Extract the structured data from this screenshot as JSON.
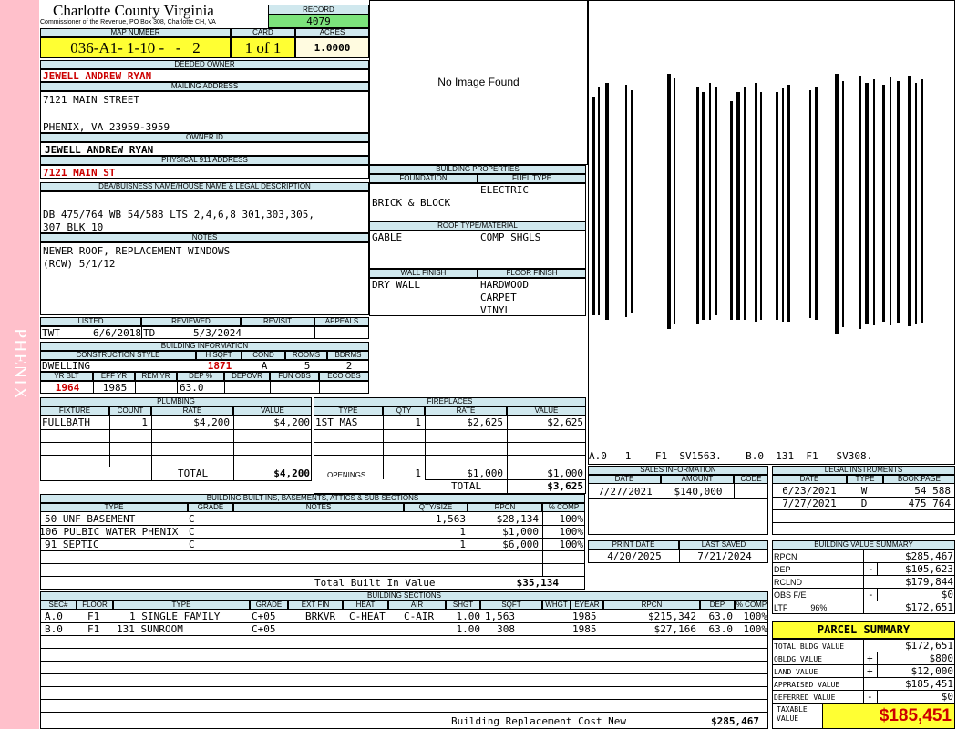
{
  "sidebar": {
    "text": "PHENIX",
    "color": "#ffc0cb"
  },
  "header": {
    "title": "Charlotte County Virginia",
    "subtitle": "Commissioner of the Revenue, PO Box 308, Charlotte CH, VA",
    "record_label": "RECORD",
    "record": "4079"
  },
  "map": {
    "map_label": "MAP NUMBER",
    "map_number": "036-A1- 1-10 -   -   2",
    "card_label": "CARD",
    "card": "1 of 1",
    "acres_label": "ACRES",
    "acres": "1.0000"
  },
  "owner": {
    "deeded_label": "DEEDED OWNER",
    "deeded_owner": "JEWELL ANDREW RYAN",
    "mailing_label": "MAILING ADDRESS",
    "mailing_line1": "7121 MAIN STREET",
    "mailing_line2": "PHENIX, VA 23959-3959",
    "owner_id_label": "OWNER ID",
    "owner_id": "JEWELL ANDREW RYAN",
    "address_label": "PHYSICAL 911 ADDRESS",
    "address": "7121 MAIN ST"
  },
  "legal": {
    "label": "DBA/BUISNESS NAME/HOUSE NAME & LEGAL DESCRIPTION",
    "line1": "DB 475/764 WB 54/588 LTS 2,4,6,8 301,303,305,",
    "line2": "307 BLK 10"
  },
  "notes": {
    "label": "NOTES",
    "line1": "NEWER ROOF, REPLACEMENT WINDOWS",
    "line2": "(RCW) 5/1/12"
  },
  "photo": {
    "text": "No Image Found"
  },
  "listing": {
    "listed_label": "LISTED",
    "reviewed_label": "REVIEWED",
    "revisit_label": "REVISIT",
    "appeals_label": "APPEALS",
    "listed_by": "TWT",
    "listed_date": "6/6/2018",
    "reviewed_by": "TD",
    "reviewed_date": "5/3/2024"
  },
  "building_info": {
    "label": "BUILDING INFORMATION",
    "style_label": "CONSTRUCTION STYLE",
    "hsqft_label": "H SQFT",
    "cond_label": "COND",
    "rooms_label": "ROOMS",
    "bdrms_label": "BDRMS",
    "style": "DWELLING",
    "hsqft": "1871",
    "cond": "A",
    "rooms": "5",
    "bdrms": "2",
    "yrblt_label": "YR BLT",
    "effyr_label": "EFF YR",
    "remyr_label": "REM YR",
    "dep_label": "DEP %",
    "depovr_label": "DEPOVR",
    "funobs_label": "FUN OBS",
    "ecoobs_label": "ECO OBS",
    "yrblt": "1964",
    "effyr": "1985",
    "dep": "63.0"
  },
  "props": {
    "label": "BUILDING PROPERTIES",
    "foundation_label": "FOUNDATION",
    "fuel_label": "FUEL TYPE",
    "foundation": "BRICK & BLOCK",
    "fuel": "ELECTRIC",
    "roof_label": "ROOF TYPE/MATERIAL",
    "roof_type": "GABLE",
    "roof_material": "COMP SHGLS",
    "wall_label": "WALL FINISH",
    "floor_label": "FLOOR FINISH",
    "wall": "DRY WALL",
    "floor1": "HARDWOOD",
    "floor2": "CARPET",
    "floor3": "VINYL"
  },
  "sketch": {
    "caption": "A.0   1    F1  SV1563.    B.0  131  F1   SV308."
  },
  "plumbing": {
    "label": "PLUMBING",
    "headers": [
      "FIXTURE",
      "COUNT",
      "RATE",
      "VALUE"
    ],
    "row": [
      "FULLBATH",
      "1",
      "$4,200",
      "$4,200"
    ],
    "total_label": "TOTAL",
    "total": "$4,200"
  },
  "fireplaces": {
    "label": "FIREPLACES",
    "headers": [
      "TYPE",
      "QTY",
      "RATE",
      "VALUE"
    ],
    "row": [
      "1ST MAS",
      "1",
      "$2,625",
      "$2,625"
    ],
    "openings_label": "OPENINGS",
    "openings": [
      "1",
      "$1,000",
      "$1,000"
    ],
    "total_label": "TOTAL",
    "total": "$3,625"
  },
  "sales": {
    "label": "SALES INFORMATION",
    "headers": [
      "DATE",
      "AMOUNT",
      "CODE"
    ],
    "row": [
      "7/27/2021",
      "$140,000",
      ""
    ]
  },
  "legal_instr": {
    "label": "LEGAL INSTRUMENTS",
    "headers": [
      "DATE",
      "TYPE",
      "BOOK:PAGE"
    ],
    "rows": [
      [
        "6/23/2021",
        "W",
        "54 588"
      ],
      [
        "7/27/2021",
        "D",
        "475 764"
      ]
    ]
  },
  "builtins": {
    "label": "BUILDING BUILT INS, BASEMENTS, ATTICS & SUB SECTIONS",
    "headers": [
      "TYPE",
      "GRADE",
      "NOTES",
      "QTY/SIZE",
      "RPCN",
      "% COMP"
    ],
    "rows": [
      [
        "50 UNF BASEMENT",
        "C",
        "",
        "1,563",
        "$28,134",
        "100%"
      ],
      [
        "106 PULBIC WATER PHENIX",
        "C",
        "",
        "1",
        "$1,000",
        "100%"
      ],
      [
        "91 SEPTIC",
        "C",
        "",
        "1",
        "$6,000",
        "100%"
      ]
    ],
    "total_label": "Total Built In Value",
    "total": "$35,134"
  },
  "dates": {
    "print_label": "PRINT DATE",
    "saved_label": "LAST SAVED",
    "print_date": "4/20/2025",
    "last_saved": "7/21/2024"
  },
  "value_summary": {
    "label": "BUILDING VALUE SUMMARY",
    "rows": [
      [
        "RPCN",
        "",
        "$285,467"
      ],
      [
        "DEP",
        "-",
        "$105,623"
      ],
      [
        "RCLND",
        "",
        "$179,844"
      ],
      [
        "OBS F/E",
        "-",
        "$0"
      ],
      [
        "LTF          96%",
        "",
        "$172,651"
      ]
    ]
  },
  "sections": {
    "label": "BUILDING SECTIONS",
    "headers": [
      "SEC#",
      "FLOOR",
      "TYPE",
      "GRADE",
      "EXT FIN",
      "HEAT",
      "AIR",
      "SHGT",
      "SQFT",
      "WHGT",
      "EYEAR",
      "RPCN",
      "DEP",
      "% COMP"
    ],
    "rows": [
      [
        "A.0",
        "F1",
        "1 SINGLE FAMILY",
        "C+05",
        "BRKVR",
        "C-HEAT",
        "C-AIR",
        "1.00",
        "1,563",
        "",
        "1985",
        "$215,342",
        "63.0",
        "100%"
      ],
      [
        "B.0",
        "F1",
        "131 SUNROOM",
        "C+05",
        "",
        "",
        "",
        "1.00",
        "308",
        "",
        "1985",
        "$27,166",
        "63.0",
        "100%"
      ]
    ],
    "brcn_label": "Building Replacement Cost New",
    "brcn": "$285,467"
  },
  "parcel": {
    "label": "PARCEL SUMMARY",
    "rows": [
      [
        "TOTAL BLDG VALUE",
        "",
        "$172,651"
      ],
      [
        "OBLDG VALUE",
        "+",
        "$800"
      ],
      [
        "LAND VALUE",
        "+",
        "$12,000"
      ],
      [
        "APPRAISED VALUE",
        "",
        "$185,451"
      ],
      [
        "DEFERRED VALUE",
        "-",
        "$0"
      ]
    ],
    "taxable_label": "TAXABLE VALUE",
    "taxable": "$185,451"
  }
}
